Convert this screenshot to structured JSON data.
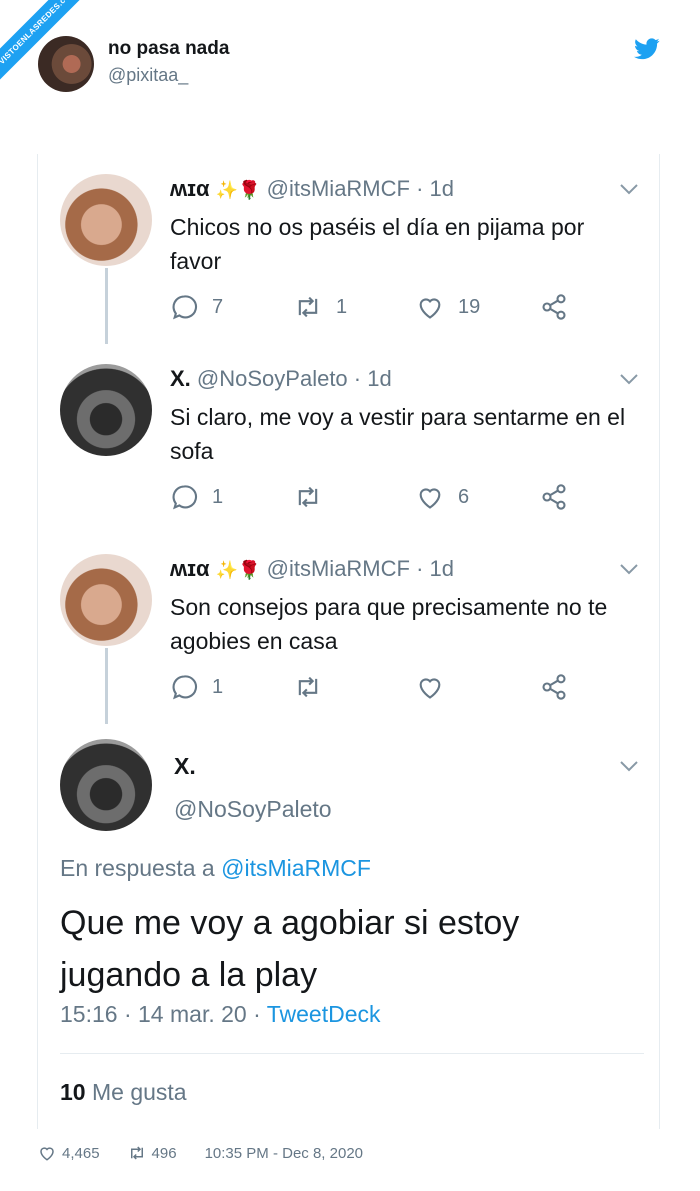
{
  "watermark": {
    "text": "VISTOENLASREDES.com"
  },
  "embed": {
    "author_name": "no pasa nada",
    "author_handle": "@pixitaa_",
    "footer": {
      "likes": "4,465",
      "retweets": "496",
      "timestamp": "10:35 PM - Dec 8, 2020"
    }
  },
  "colors": {
    "accent": "#1da1f2",
    "link": "#1b95e0",
    "muted": "#657786",
    "text": "#14171a"
  },
  "thread": [
    {
      "name": "ʍɪα",
      "emoji": "✨🌹",
      "handle": "@itsMiaRMCF",
      "time": "1d",
      "text": "Chicos no os paséis el día en pijama por favor",
      "replies": "7",
      "retweets": "1",
      "likes": "19"
    },
    {
      "name": "X.",
      "emoji": "",
      "handle": "@NoSoyPaleto",
      "time": "1d",
      "text": "Si claro, me voy a vestir para sentarme en el sofa",
      "replies": "1",
      "retweets": "",
      "likes": "6"
    },
    {
      "name": "ʍɪα",
      "emoji": "✨🌹",
      "handle": "@itsMiaRMCF",
      "time": "1d",
      "text": "Son consejos para que precisamente no te agobies en casa",
      "replies": "1",
      "retweets": "",
      "likes": ""
    }
  ],
  "main_tweet": {
    "name": "X.",
    "handle": "@NoSoyPaleto",
    "replying_prefix": "En respuesta a",
    "replying_to": "@itsMiaRMCF",
    "text": "Que me voy a agobiar si estoy jugando a la play",
    "time": "15:16",
    "date": "14 mar. 20",
    "client": "TweetDeck",
    "likes_count": "10",
    "likes_label": "Me gusta"
  }
}
